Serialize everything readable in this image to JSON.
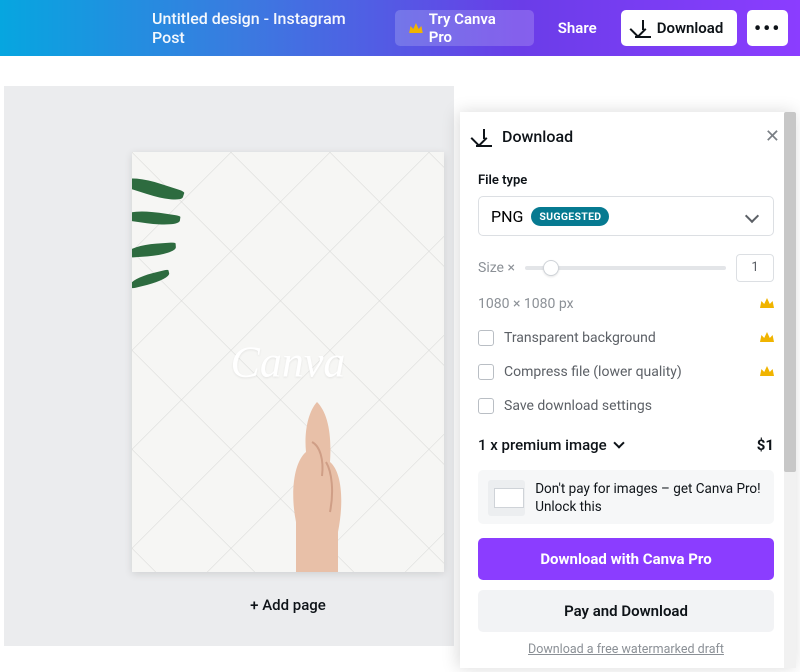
{
  "topbar": {
    "doc_title": "Untitled design - Instagram Post",
    "try_pro": "Try Canva Pro",
    "share": "Share",
    "download": "Download",
    "more": "•••"
  },
  "canvas": {
    "watermark": "Canva",
    "add_page": "+ Add page"
  },
  "panel": {
    "title": "Download",
    "file_type_label": "File type",
    "file_type_value": "PNG",
    "file_type_badge": "SUGGESTED",
    "size_label": "Size ×",
    "size_value": "1",
    "dimensions": "1080 × 1080 px",
    "opt_transparent": "Transparent background",
    "opt_compress": "Compress file (lower quality)",
    "opt_save": "Save download settings",
    "premium_summary": "1 x premium image",
    "premium_price": "$1",
    "promo_text": "Don't pay for images – get Canva Pro! Unlock this",
    "cta_primary": "Download with Canva Pro",
    "cta_secondary": "Pay and Download",
    "watermark_link": "Download a free watermarked draft"
  }
}
